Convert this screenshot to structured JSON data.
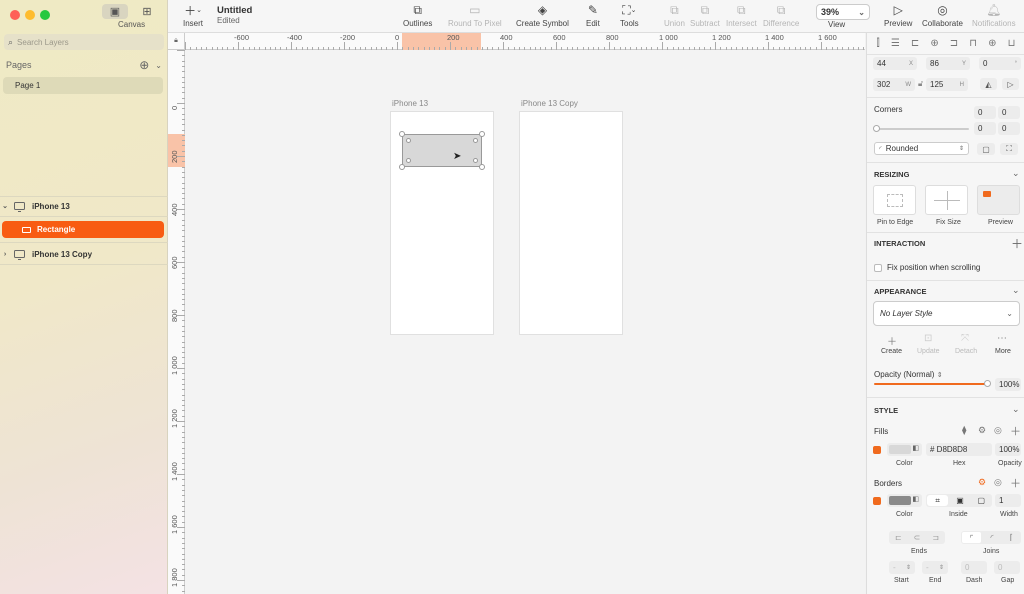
{
  "sidebar": {
    "canvas_label": "Canvas",
    "search_placeholder": "Search Layers",
    "pages_label": "Pages",
    "pages": [
      "Page 1"
    ],
    "layers": {
      "artboard1": "iPhone 13",
      "selected": "Rectangle",
      "artboard2": "iPhone 13 Copy"
    }
  },
  "toolbar": {
    "insert": "Insert",
    "doc_title": "Untitled",
    "doc_status": "Edited",
    "outlines": "Outlines",
    "round_to_pixel": "Round To Pixel",
    "create_symbol": "Create Symbol",
    "edit": "Edit",
    "tools": "Tools",
    "union": "Union",
    "subtract": "Subtract",
    "intersect": "Intersect",
    "difference": "Difference",
    "zoom_value": "39%",
    "view": "View",
    "preview": "Preview",
    "collaborate": "Collaborate",
    "notifications": "Notifications"
  },
  "rulers": {
    "h_labels": [
      "-600",
      "-400",
      "-200",
      "0",
      "200",
      "400",
      "600",
      "800",
      "1 000",
      "1 200",
      "1 400",
      "1 600"
    ],
    "v_labels": [
      "0",
      "200",
      "400",
      "600",
      "800",
      "1 000",
      "1 200",
      "1 400",
      "1 600",
      "1 800"
    ]
  },
  "canvas": {
    "artboard1_label": "iPhone 13",
    "artboard2_label": "iPhone 13 Copy"
  },
  "inspector": {
    "x": "44",
    "x_unit": "X",
    "y": "86",
    "y_unit": "Y",
    "rotation": "0",
    "rotation_unit": "°",
    "w": "302",
    "w_unit": "W",
    "h": "125",
    "h_unit": "H",
    "corners_label": "Corners",
    "corner_values": [
      "0",
      "0",
      "0",
      "0"
    ],
    "corner_style": "Rounded",
    "resizing": "RESIZING",
    "pin_to_edge": "Pin to Edge",
    "fix_size": "Fix Size",
    "preview": "Preview",
    "interaction": "INTERACTION",
    "fix_position": "Fix position when scrolling",
    "appearance": "APPEARANCE",
    "layer_style": "No Layer Style",
    "create": "Create",
    "update": "Update",
    "detach": "Detach",
    "more": "More",
    "opacity_label": "Opacity (Normal)",
    "opacity_value": "100%",
    "style": "STYLE",
    "fills": "Fills",
    "fill_hex": "# D8D8D8",
    "fill_opacity": "100%",
    "color_label": "Color",
    "hex_label": "Hex",
    "opacity_small": "Opacity",
    "borders": "Borders",
    "border_width": "1",
    "inside_label": "Inside",
    "width_label": "Width",
    "ends_label": "Ends",
    "joins_label": "Joins",
    "start_label": "Start",
    "end_label": "End",
    "dash_label": "Dash",
    "gap_label": "Gap",
    "dash_value": "0",
    "gap_value": "0"
  },
  "colors": {
    "accent": "#f85c12",
    "fill": "#D8D8D8",
    "border": "#8a8a8a"
  }
}
